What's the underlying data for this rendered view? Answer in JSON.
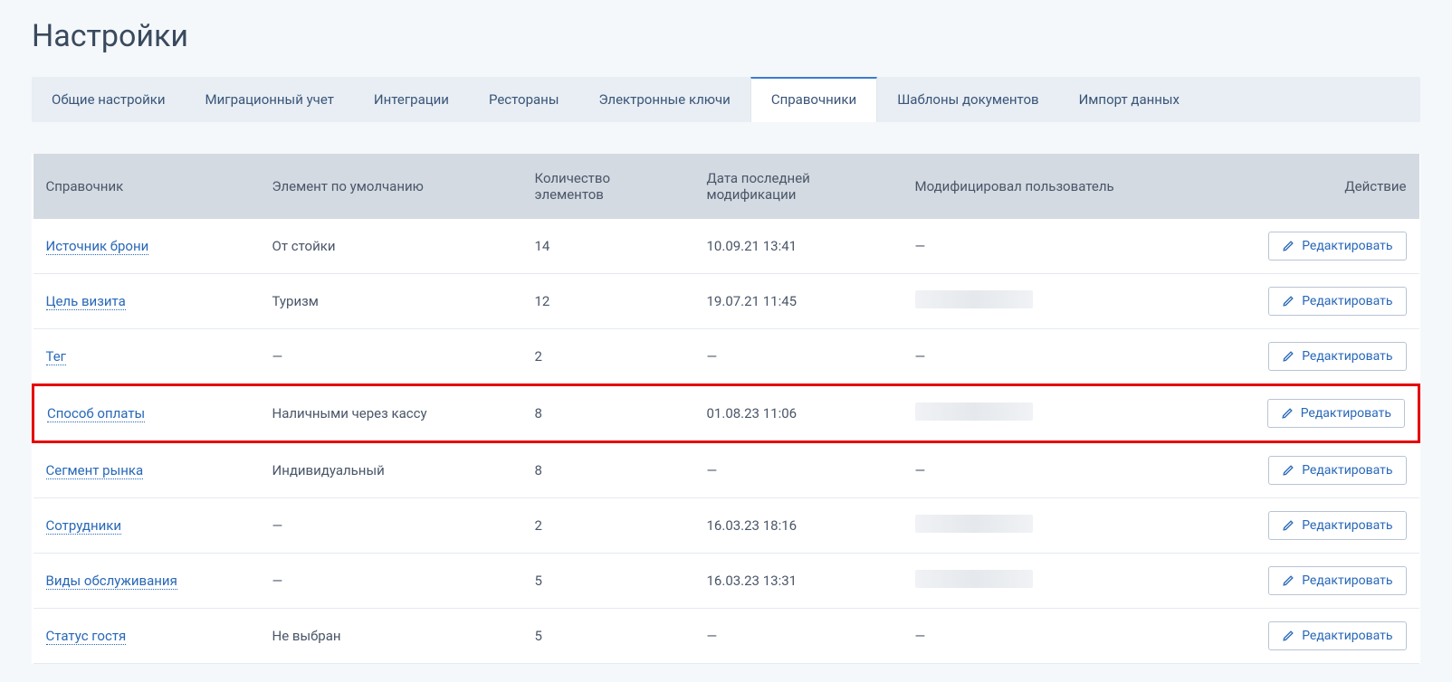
{
  "page_title": "Настройки",
  "tabs": [
    {
      "label": "Общие настройки",
      "active": false
    },
    {
      "label": "Миграционный учет",
      "active": false
    },
    {
      "label": "Интеграции",
      "active": false
    },
    {
      "label": "Рестораны",
      "active": false
    },
    {
      "label": "Электронные ключи",
      "active": false
    },
    {
      "label": "Справочники",
      "active": true
    },
    {
      "label": "Шаблоны документов",
      "active": false
    },
    {
      "label": "Импорт данных",
      "active": false
    }
  ],
  "table": {
    "headers": {
      "name": "Справочник",
      "default_element": "Элемент по умолчанию",
      "count": "Количество элементов",
      "last_modified": "Дата последней модификации",
      "modified_by": "Модифицировал пользователь",
      "action": "Действие"
    },
    "edit_label": "Редактировать",
    "rows": [
      {
        "name": "Источник брони",
        "default_element": "От стойки",
        "count": "14",
        "last_modified": "10.09.21 13:41",
        "modified_by": "—",
        "redacted": false,
        "highlighted": false
      },
      {
        "name": "Цель визита",
        "default_element": "Туризм",
        "count": "12",
        "last_modified": "19.07.21 11:45",
        "modified_by": "",
        "redacted": true,
        "highlighted": false
      },
      {
        "name": "Тег",
        "default_element": "—",
        "count": "2",
        "last_modified": "—",
        "modified_by": "—",
        "redacted": false,
        "highlighted": false
      },
      {
        "name": "Способ оплаты",
        "default_element": "Наличными через кассу",
        "count": "8",
        "last_modified": "01.08.23 11:06",
        "modified_by": "",
        "redacted": true,
        "highlighted": true
      },
      {
        "name": "Сегмент рынка",
        "default_element": "Индивидуальный",
        "count": "8",
        "last_modified": "—",
        "modified_by": "—",
        "redacted": false,
        "highlighted": false
      },
      {
        "name": "Сотрудники",
        "default_element": "—",
        "count": "2",
        "last_modified": "16.03.23 18:16",
        "modified_by": "",
        "redacted": true,
        "highlighted": false
      },
      {
        "name": "Виды обслуживания",
        "default_element": "—",
        "count": "5",
        "last_modified": "16.03.23 13:31",
        "modified_by": "",
        "redacted": true,
        "highlighted": false
      },
      {
        "name": "Статус гостя",
        "default_element": "Не выбран",
        "count": "5",
        "last_modified": "—",
        "modified_by": "—",
        "redacted": false,
        "highlighted": false
      }
    ]
  }
}
